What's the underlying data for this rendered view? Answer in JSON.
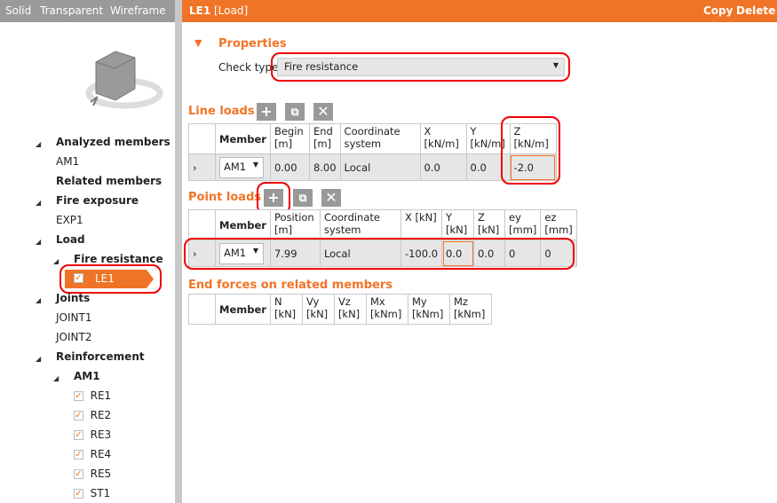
{
  "toolbar": {
    "solid": "Solid",
    "transparent": "Transparent",
    "wireframe": "Wireframe"
  },
  "header": {
    "title": "LE1",
    "subtitle": "[Load]",
    "copy": "Copy",
    "delete": "Delete"
  },
  "tree": {
    "analyzed_members": "Analyzed members",
    "am1": "AM1",
    "related_members": "Related members",
    "fire_exposure": "Fire exposure",
    "exp1": "EXP1",
    "load": "Load",
    "fire_resistance": "Fire resistance",
    "le1": "LE1",
    "joints": "Joints",
    "joint1": "JOINT1",
    "joint2": "JOINT2",
    "reinforcement": "Reinforcement",
    "reinf_am1": "AM1",
    "items": [
      "RE1",
      "RE2",
      "RE3",
      "RE4",
      "RE5",
      "ST1"
    ]
  },
  "properties": {
    "title": "Properties",
    "check_type_label": "Check type",
    "check_type_value": "Fire resistance"
  },
  "line_loads": {
    "title": "Line loads",
    "headers": [
      "Member",
      "Begin [m]",
      "End [m]",
      "Coordinate system",
      "X [kN/m]",
      "Y [kN/m]",
      "Z [kN/m]"
    ],
    "row": {
      "member": "AM1",
      "begin": "0.00",
      "end": "8.00",
      "cs": "Local",
      "x": "0.0",
      "y": "0.0",
      "z": "-2.0"
    }
  },
  "point_loads": {
    "title": "Point loads",
    "headers": [
      "Member",
      "Position [m]",
      "Coordinate system",
      "X [kN]",
      "Y [kN]",
      "Z [kN]",
      "ey [mm]",
      "ez [mm]"
    ],
    "row": {
      "member": "AM1",
      "position": "7.99",
      "cs": "Local",
      "x": "-100.0",
      "y": "0.0",
      "z": "0.0",
      "ey": "0",
      "ez": "0"
    }
  },
  "end_forces": {
    "title": "End forces on related members",
    "headers": [
      "Member",
      "N [kN]",
      "Vy [kN]",
      "Vz [kN]",
      "Mx [kNm]",
      "My [kNm]",
      "Mz [kNm]"
    ]
  },
  "colors": {
    "accent": "#f07427",
    "highlight": "#e00000"
  }
}
